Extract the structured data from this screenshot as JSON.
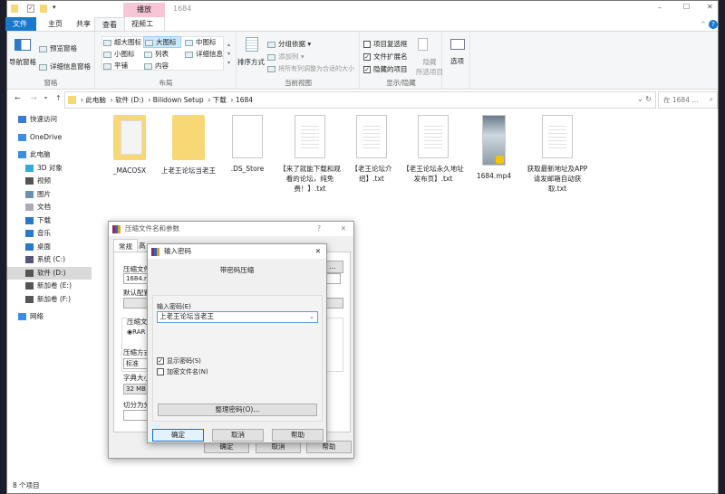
{
  "window": {
    "title": "1684",
    "context_tab": "播放",
    "controls": [
      "–",
      "☐",
      "✕"
    ]
  },
  "tabs": [
    {
      "label": "文件",
      "active": false
    },
    {
      "label": "主页"
    },
    {
      "label": "共享"
    },
    {
      "label": "查看",
      "active": true
    },
    {
      "label": "视频工具"
    }
  ],
  "ribbon": {
    "panes": {
      "label": "窗格",
      "nav": "导航窗格",
      "preview": "预览窗格",
      "details": "详细信息窗格"
    },
    "layout": {
      "label": "布局",
      "items": [
        "超大图标",
        "大图标",
        "中图标",
        "小图标",
        "列表",
        "详细信息",
        "平铺",
        "内容"
      ],
      "selected": "大图标"
    },
    "current_view": {
      "label": "当前视图",
      "sort": "排序方式",
      "group": "分组依据",
      "add_col": "添加列",
      "fit_cols": "将所有列调整为合适的大小"
    },
    "show_hide": {
      "label": "显示/隐藏",
      "checkbox_items": {
        "label": "项目复选框",
        "checked": false
      },
      "extensions": {
        "label": "文件扩展名",
        "checked": true
      },
      "hidden": {
        "label": "隐藏的项目",
        "checked": true
      },
      "hide_selected_1": "隐藏",
      "hide_selected_2": "所选项目"
    },
    "options": "选项"
  },
  "address": {
    "crumbs": [
      "此电脑",
      "软件 (D:)",
      "Bilidown Setup",
      "下载",
      "1684"
    ],
    "search_placeholder": "在 1684 ..."
  },
  "sidebar": [
    {
      "label": "快速访问"
    },
    {
      "label": "OneDrive"
    },
    {
      "label": "此电脑"
    },
    {
      "label": "3D 对象"
    },
    {
      "label": "视频"
    },
    {
      "label": "图片"
    },
    {
      "label": "文档"
    },
    {
      "label": "下载"
    },
    {
      "label": "音乐"
    },
    {
      "label": "桌面"
    },
    {
      "label": "系统 (C:)"
    },
    {
      "label": "软件 (D:)",
      "selected": true
    },
    {
      "label": "新加卷 (E:)"
    },
    {
      "label": "新加卷 (F:)"
    },
    {
      "label": "网络"
    }
  ],
  "files": [
    {
      "name": "_MACOSX",
      "type": "folder"
    },
    {
      "name": "上老王论坛当老王",
      "type": "folder"
    },
    {
      "name": ".DS_Store",
      "type": "file"
    },
    {
      "name": "【来了就能下载和观看的论坛，纯免费！】.txt",
      "type": "txt"
    },
    {
      "name": "【老王论坛介绍】.txt",
      "type": "txt"
    },
    {
      "name": "【老王论坛永久地址发布页】.txt",
      "type": "txt"
    },
    {
      "name": "1684.mp4",
      "type": "video"
    },
    {
      "name": "获取最新地址及APP请发邮箱自动获取.txt",
      "type": "txt"
    }
  ],
  "status": "8 个项目",
  "archive_dialog": {
    "title": "压缩文件名和参数",
    "help": "?",
    "tabs": [
      "常规",
      "高"
    ],
    "archive_name_label": "压缩文件",
    "archive_name": "1684.rar",
    "browse": "...",
    "profile_label": "默认配置",
    "format_label": "压缩文",
    "format_rar": "RAR",
    "method_label": "压缩方式",
    "method": "标准",
    "dict_label": "字典大小",
    "dict": "32 MB",
    "split_label": "切分为分",
    "ok": "确定",
    "cancel": "取消",
    "help_btn": "帮助"
  },
  "password_dialog": {
    "title": "输入密码",
    "heading": "带密码压缩",
    "password_label": "输入密码(E)",
    "password": "上老王论坛当老王",
    "show_password": {
      "label": "显示密码(S)",
      "checked": true
    },
    "encrypt_names": {
      "label": "加密文件名(N)",
      "checked": false
    },
    "organize": "整理密码(O)...",
    "ok": "确定",
    "cancel": "取消",
    "help": "帮助"
  },
  "colors": {
    "accent": "#1979ca",
    "context_tab": "#f7c6d6",
    "folder": "#f8d775",
    "selected": "#cce8ff"
  }
}
